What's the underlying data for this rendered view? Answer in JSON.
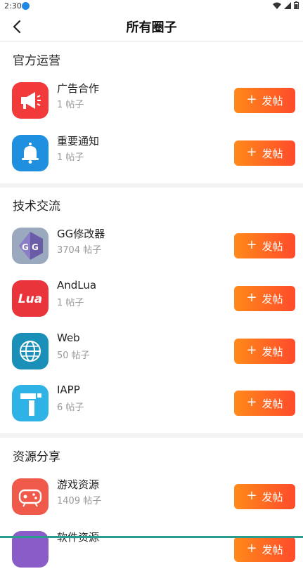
{
  "status_bar": {
    "time": "2:30"
  },
  "header": {
    "title": "所有圈子"
  },
  "sections": [
    {
      "title": "官方运营",
      "items": [
        {
          "name": "广告合作",
          "count": "1 帖子",
          "post_label": "发帖",
          "icon": "megaphone-icon",
          "color": "#f23a3a"
        },
        {
          "name": "重要通知",
          "count": "1 帖子",
          "post_label": "发帖",
          "icon": "bell-icon",
          "color": "#1f8fe0"
        }
      ]
    },
    {
      "title": "技术交流",
      "items": [
        {
          "name": "GG修改器",
          "count": "3704 帖子",
          "post_label": "发帖",
          "icon": "gg-logo-icon",
          "color": "#6b5ca8"
        },
        {
          "name": "AndLua",
          "count": "1 帖子",
          "post_label": "发帖",
          "icon": "lua-logo-icon",
          "color": "#e8343a",
          "logo_text": "Lua"
        },
        {
          "name": "Web",
          "count": "50 帖子",
          "post_label": "发帖",
          "icon": "globe-icon",
          "color": "#1a8fb8"
        },
        {
          "name": "IAPP",
          "count": "6 帖子",
          "post_label": "发帖",
          "icon": "iapp-logo-icon",
          "color": "#2fb2e6"
        }
      ]
    },
    {
      "title": "资源分享",
      "items": [
        {
          "name": "游戏资源",
          "count": "1409 帖子",
          "post_label": "发帖",
          "icon": "gamepad-icon",
          "color": "#f05a4a"
        },
        {
          "name": "软件资源",
          "count": "",
          "post_label": "发帖",
          "icon": "app-resource-icon",
          "color": "#8a5cc8"
        }
      ]
    }
  ]
}
